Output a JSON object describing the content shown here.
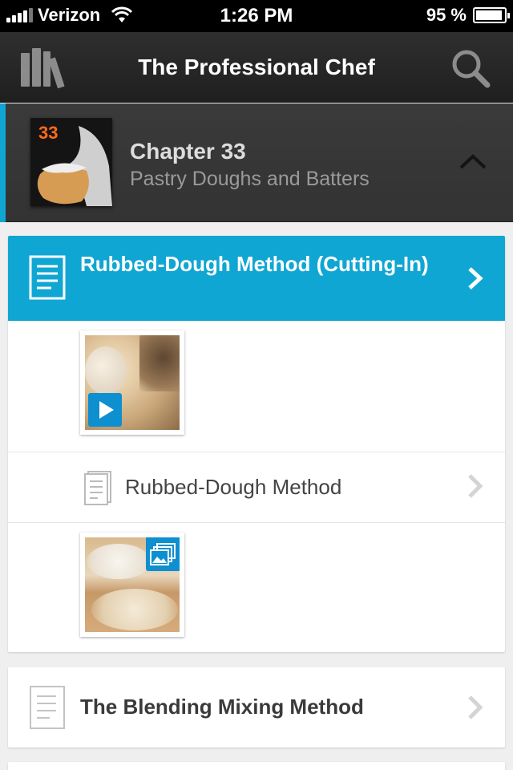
{
  "status_bar": {
    "carrier": "Verizon",
    "time": "1:26 PM",
    "battery": "95 %",
    "battery_level": 0.95
  },
  "nav": {
    "title": "The Professional Chef",
    "left_icon": "library-icon",
    "right_icon": "search-icon"
  },
  "chapter": {
    "number": "33",
    "title": "Chapter 33",
    "subtitle": "Pastry Doughs and Batters",
    "toggle_icon": "chevron-up-icon"
  },
  "sections": [
    {
      "title": "Rubbed-Dough Method (Cutting-In)",
      "active": true,
      "items": [
        {
          "type": "video",
          "icon": "play-icon"
        },
        {
          "type": "text",
          "label": "Rubbed-Dough Method",
          "icon": "document-icon"
        },
        {
          "type": "gallery",
          "icon": "gallery-icon"
        }
      ]
    },
    {
      "title": "The Blending Mixing Method",
      "active": false
    }
  ],
  "colors": {
    "accent": "#10a6d3",
    "chapter_number": "#ff6a1a",
    "media_badge": "#0d8fd0",
    "nav_background": "#262626"
  }
}
